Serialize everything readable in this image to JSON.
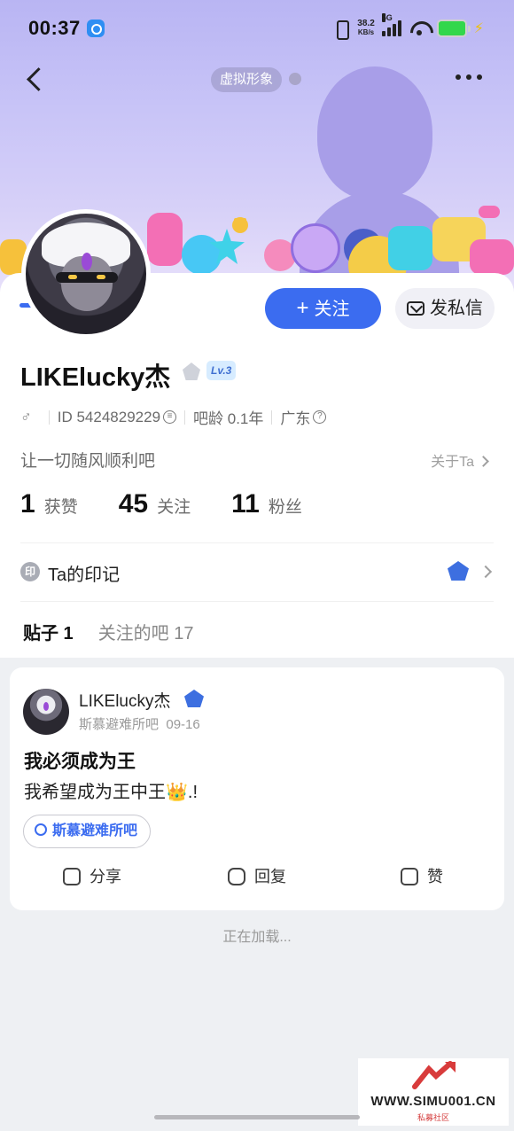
{
  "status_bar": {
    "time": "00:37",
    "net_speed_value": "38.2",
    "net_speed_unit": "KB/s",
    "network": "5G"
  },
  "header": {
    "avatar_tag": "虚拟形象"
  },
  "profile": {
    "username": "LIKElucky杰",
    "level": "Lv.3",
    "gender_icon": "♂",
    "id_text": "ID 5424829229",
    "bar_age": "吧龄 0.1年",
    "location": "广东",
    "bio": "让一切随风顺利吧",
    "about_link": "关于Ta",
    "follow_button": "关注",
    "follow_plus": "+",
    "message_button": "发私信",
    "stats": [
      {
        "value": "1",
        "label": "获赞"
      },
      {
        "value": "45",
        "label": "关注"
      },
      {
        "value": "11",
        "label": "粉丝"
      }
    ],
    "imprint_label": "Ta的印记",
    "imprint_icon": "印"
  },
  "tabs": [
    {
      "label": "贴子 1",
      "active": true
    },
    {
      "label": "关注的吧 17",
      "active": false
    }
  ],
  "post": {
    "author": "LIKElucky杰",
    "forum": "斯慕避难所吧",
    "date": "09-16",
    "title": "我必须成为王",
    "body": "我希望成为王中王👑.!",
    "forum_tag": "斯慕避难所吧",
    "actions": [
      {
        "label": "分享",
        "icon": "share-icon"
      },
      {
        "label": "回复",
        "icon": "reply-icon"
      },
      {
        "label": "赞",
        "icon": "thumbs-up-icon"
      }
    ]
  },
  "loading_text": "正在加载...",
  "watermark": {
    "url": "WWW.SIMU001.CN",
    "subtitle": "私募社区"
  },
  "colors": {
    "accent": "#3b6cf0",
    "banner": "#c7c3f7",
    "background": "#eef0f3"
  }
}
